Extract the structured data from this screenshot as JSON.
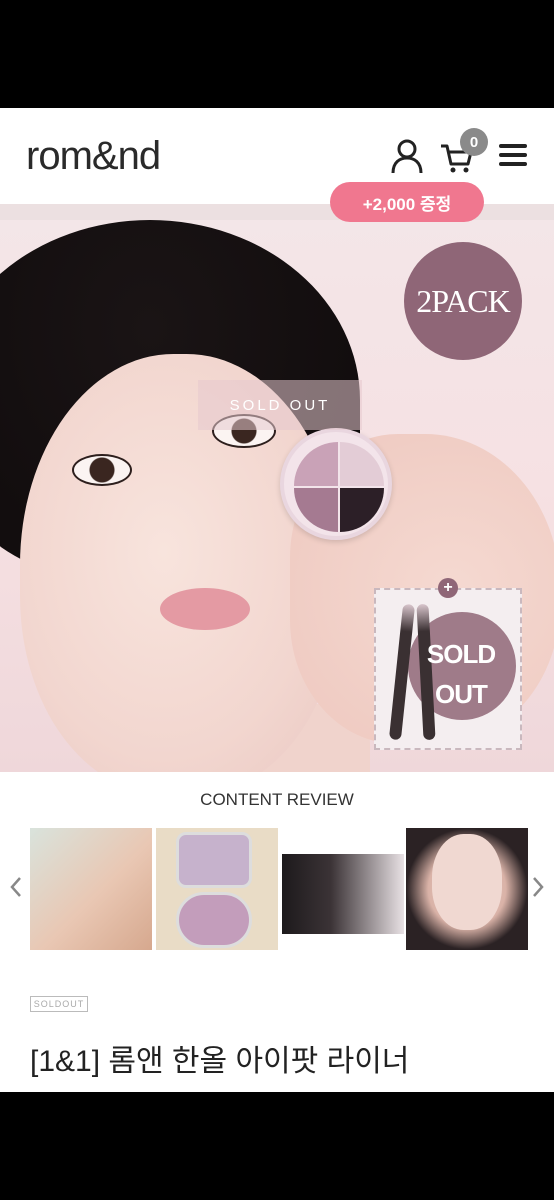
{
  "header": {
    "logo": "rom&nd",
    "cart_count": "0",
    "promo_badge": "+2,000 증정"
  },
  "hero": {
    "pack_badge": "2PACK",
    "soldout_overlay": "SOLD OUT",
    "liner_plus": "+",
    "liner_soldout_line1": "SOLD",
    "liner_soldout_line2": "OUT"
  },
  "review": {
    "title": "CONTENT REVIEW"
  },
  "product": {
    "soldout_tag": "SOLDOUT",
    "title": "[1&1] 롬앤 한올 아이팟 라이너"
  },
  "colors": {
    "accent_pink": "#f0778f",
    "badge_mauve": "#8f6677"
  },
  "icons": [
    "user-icon",
    "cart-icon",
    "menu-icon",
    "chevron-left-icon",
    "chevron-right-icon"
  ]
}
